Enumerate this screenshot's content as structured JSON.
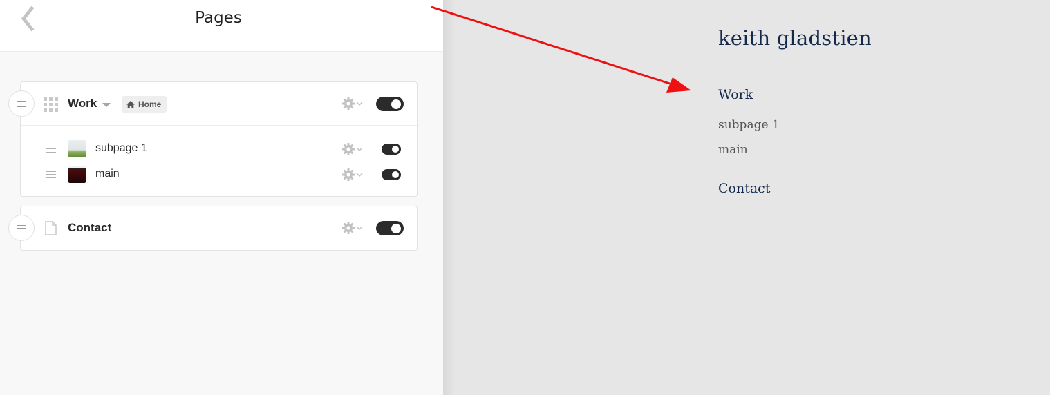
{
  "panel": {
    "title": "Pages",
    "back_icon": "chevron-left-icon"
  },
  "groups": [
    {
      "title": "Work",
      "icon": "grid-icon",
      "badge": {
        "icon": "home-icon",
        "label": "Home"
      },
      "enabled": true,
      "children": [
        {
          "label": "subpage 1",
          "thumbnail": "landscape-thumbnail",
          "enabled": true
        },
        {
          "label": "main",
          "thumbnail": "dark-thumbnail",
          "enabled": true
        }
      ]
    },
    {
      "title": "Contact",
      "icon": "page-icon",
      "enabled": true,
      "children": []
    }
  ],
  "preview": {
    "site_title": "keith gladstien",
    "nav": {
      "work": "Work",
      "subpages": [
        "subpage 1",
        "main"
      ],
      "contact": "Contact"
    }
  },
  "colors": {
    "preview_text": "#13294b",
    "toggle_on": "#2b2b2b",
    "annotation_arrow": "#ee1111"
  }
}
